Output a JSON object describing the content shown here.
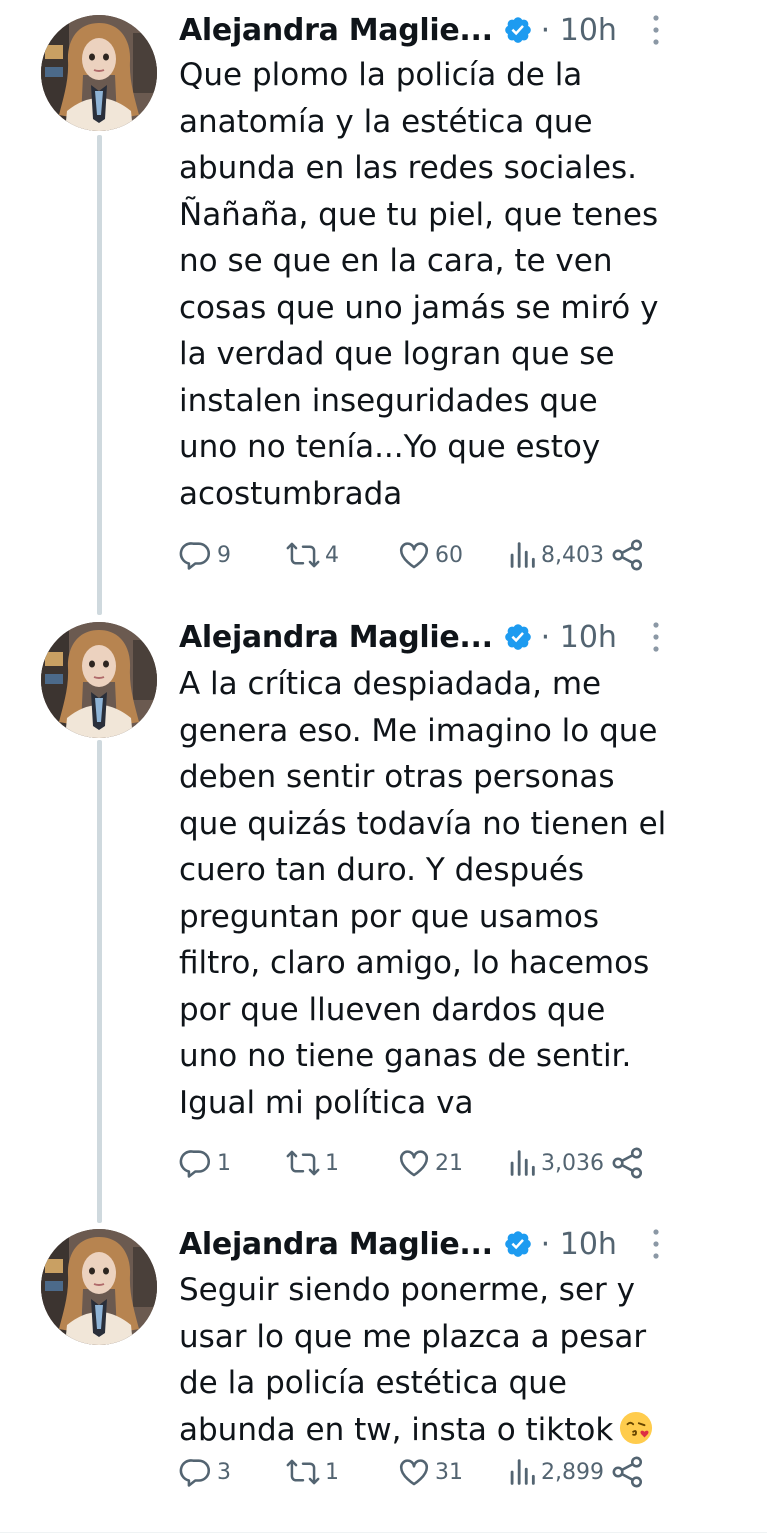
{
  "colors": {
    "text": "#0f1419",
    "secondary": "#536471",
    "verified": "#1d9bf0",
    "thread_line": "#cfd9de"
  },
  "tweets": [
    {
      "author": "Alejandra Maglie...",
      "verified": true,
      "time": "· 10h",
      "text_lines": [
        "Que plomo la policía de la",
        "anatomía y la estética que",
        "abunda en las redes sociales.",
        "Ñañaña, que tu piel, que tenes",
        "no se que en la cara, te ven",
        "cosas que uno jamás se miró y",
        "la verdad que logran que se",
        "instalen inseguridades que",
        "uno no tenía...Yo que estoy",
        "acostumbrada"
      ],
      "replies": "9",
      "retweets": "4",
      "likes": "60",
      "views": "8,403"
    },
    {
      "author": "Alejandra Maglie...",
      "verified": true,
      "time": "· 10h",
      "text_lines": [
        "A la crítica despiadada, me",
        "genera eso. Me imagino lo que",
        "deben sentir otras personas",
        "que quizás todavía no tienen el",
        "cuero tan duro. Y después",
        "preguntan por que usamos",
        "filtro, claro amigo, lo hacemos",
        "por que llueven dardos que",
        "uno no tiene ganas de sentir.",
        "Igual mi política va"
      ],
      "replies": "1",
      "retweets": "1",
      "likes": "21",
      "views": "3,036"
    },
    {
      "author": "Alejandra Maglie...",
      "verified": true,
      "time": "· 10h",
      "text_lines": [
        "Seguir siendo ponerme, ser y",
        "usar lo que me plazca a pesar",
        "de la policía estética que",
        "abunda en tw, insta o tiktok"
      ],
      "emoji": "face-blowing-a-kiss",
      "replies": "3",
      "retweets": "1",
      "likes": "31",
      "views": "2,899"
    }
  ]
}
